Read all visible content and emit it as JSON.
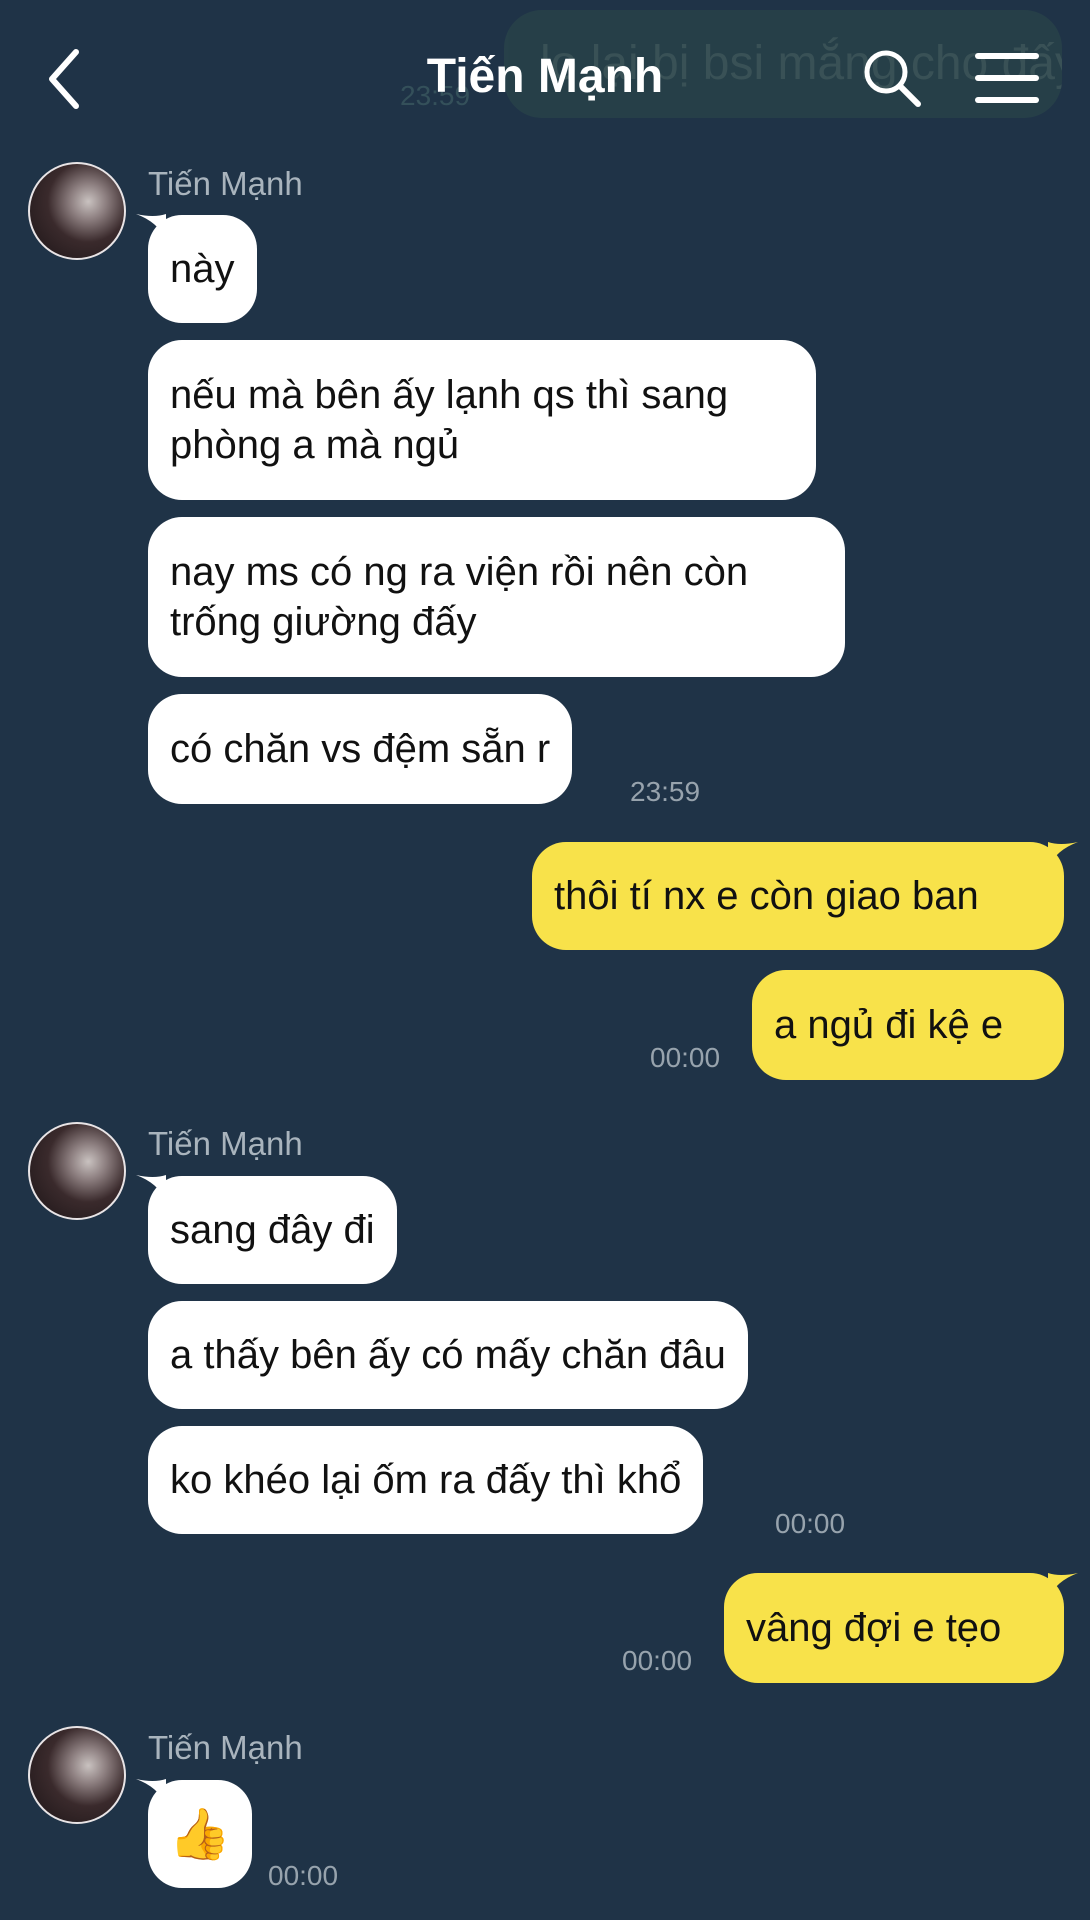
{
  "header": {
    "title": "Tiến Mạnh",
    "ghost_message": "lo lại bị bsi mắng cho đấy",
    "ghost_time": "23:59"
  },
  "messages": [
    {
      "sender": "Tiến Mạnh",
      "texts": [
        "này",
        "nếu mà bên ấy lạnh qs thì sang\nphòng a mà ngủ",
        "nay ms có ng ra viện rồi nên còn\ntrống giường đấy",
        "có chăn vs đệm sẵn r"
      ],
      "time": "23:59"
    },
    {
      "outgoing": [
        "thôi tí nx e còn giao ban",
        "a ngủ đi kệ e"
      ],
      "time": "00:00"
    },
    {
      "sender": "Tiến Mạnh",
      "texts": [
        "sang đây đi",
        "a thấy bên ấy có mấy chăn đâu",
        "ko khéo lại ốm ra đấy thì khổ"
      ],
      "time": "00:00"
    },
    {
      "outgoing": [
        "vâng đợi e tẹo"
      ],
      "time": "00:00"
    },
    {
      "sender": "Tiến Mạnh",
      "texts": [
        "👍"
      ],
      "time": "00:00"
    }
  ],
  "colors": {
    "background": "#1f3347",
    "incoming": "#ffffff",
    "outgoing": "#f8e24a"
  },
  "icons": [
    "back-arrow-icon",
    "search-icon",
    "menu-icon"
  ]
}
